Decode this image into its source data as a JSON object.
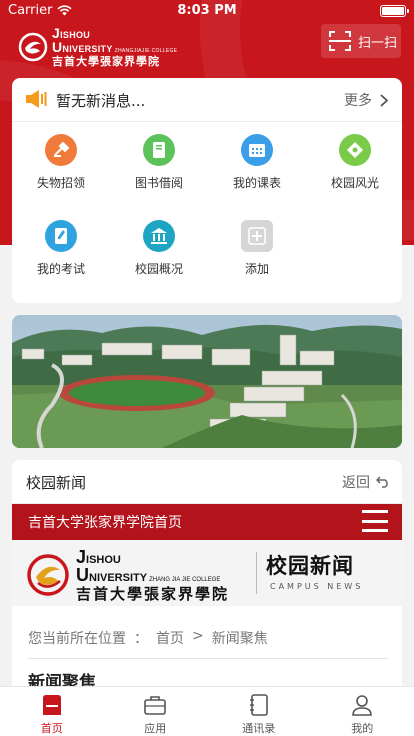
{
  "status": {
    "carrier": "Carrier",
    "time": "8:03 PM"
  },
  "header": {
    "logo": {
      "english_prefix_1": "J",
      "english_rest_1": "ISHOU",
      "english_prefix_2": "U",
      "english_rest_2": "NIVERSITY",
      "english_small": "ZHANGJIAJIE COLLEGE",
      "chinese": "吉首大學張家界學院"
    },
    "scan_label": "扫一扫"
  },
  "notice": {
    "message": "暂无新消息...",
    "more_label": "更多"
  },
  "shortcuts": [
    {
      "label": "失物招领",
      "icon": "lost-found-icon",
      "color": "#f07a3a"
    },
    {
      "label": "图书借阅",
      "icon": "book-icon",
      "color": "#5cc35a"
    },
    {
      "label": "我的课表",
      "icon": "schedule-icon",
      "color": "#3a9ee8"
    },
    {
      "label": "校园风光",
      "icon": "scenery-icon",
      "color": "#7acb4a"
    },
    {
      "label": "我的考试",
      "icon": "exam-icon",
      "color": "#2fa3e0"
    },
    {
      "label": "校园概况",
      "icon": "campus-overview-icon",
      "color": "#1ea5c4"
    },
    {
      "label": "添加",
      "icon": "add-icon",
      "color": "#d6d6d6"
    }
  ],
  "news": {
    "title": "校园新闻",
    "back_label": "返回",
    "site_title": "吉首大学张家界学院首页",
    "site_banner": {
      "english_prefix_1": "J",
      "english_rest_1": "ISHOU",
      "english_prefix_2": "U",
      "english_rest_2": "NIVERSITY",
      "english_small": "ZHANG JIA JIE COLLEGE",
      "chinese": "吉首大學張家界學院",
      "section_cn": "校园新闻",
      "section_en": "CAMPUS NEWS"
    },
    "breadcrumb": [
      "您当前所在位置",
      "：",
      "首页",
      ">",
      "新闻聚焦"
    ],
    "section_heading": "新闻聚焦"
  },
  "tabs": [
    {
      "label": "首页",
      "icon": "home-icon",
      "active": true
    },
    {
      "label": "应用",
      "icon": "briefcase-icon",
      "active": false
    },
    {
      "label": "通讯录",
      "icon": "contacts-icon",
      "active": false
    },
    {
      "label": "我的",
      "icon": "profile-icon",
      "active": false
    }
  ],
  "colors": {
    "brand_red": "#c8161d",
    "notice_orange": "#f29b1d",
    "active_tab": "#c8161d"
  }
}
